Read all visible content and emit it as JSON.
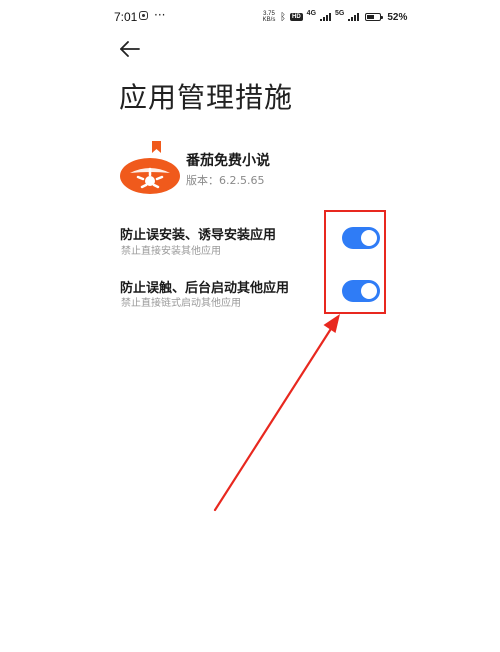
{
  "status_bar": {
    "time": "7:01",
    "more": "···",
    "net_speed_value": "3.75",
    "net_speed_unit": "KB/s",
    "hd": "HD",
    "net_1": "4G",
    "net_2": "5G",
    "battery_level": 0.52,
    "battery_text": "52%"
  },
  "header": {
    "title": "应用管理措施"
  },
  "app": {
    "name": "番茄免费小说",
    "version": "版本：6.2.5.65",
    "icon": "tomato-novel-icon",
    "brand_color": "#f05a1c"
  },
  "settings": [
    {
      "title": "防止误安装、诱导安装应用",
      "subtitle": "禁止直接安装其他应用",
      "enabled": true
    },
    {
      "title": "防止误触、后台启动其他应用",
      "subtitle": "禁止直接链式启动其他应用",
      "enabled": true
    }
  ],
  "colors": {
    "toggle_on": "#2f7cf6",
    "annotation": "#e8281f"
  }
}
